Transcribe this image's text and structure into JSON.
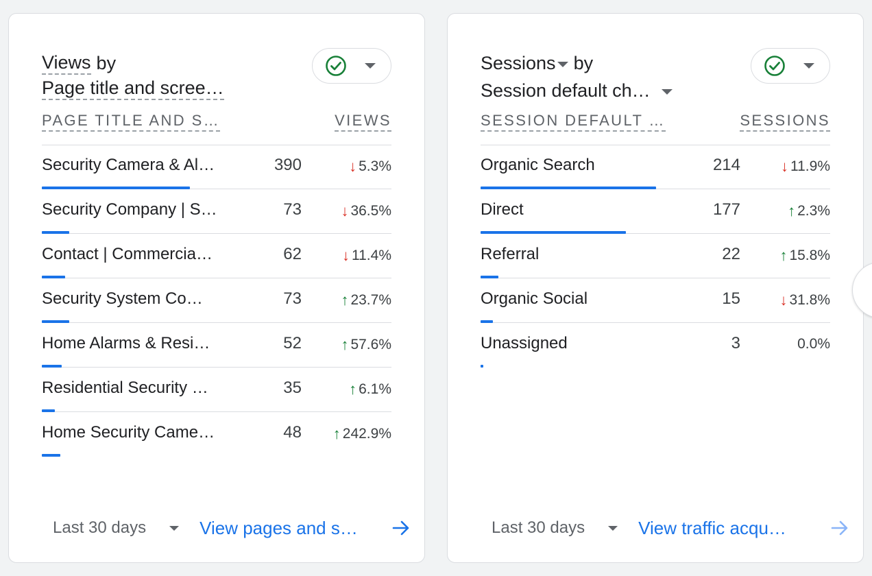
{
  "cards": [
    {
      "title_metric": "Views",
      "title_by": "by",
      "title_dimension": "Page title and scree…",
      "col_dim": "Page title and s…",
      "col_metric": "Views",
      "rows": [
        {
          "label": "Security Camera & Al…",
          "value": "390",
          "change": "5.3%",
          "dir": "down",
          "bar_fraction": 1.0
        },
        {
          "label": "Security Company | S…",
          "value": "73",
          "change": "36.5%",
          "dir": "down",
          "bar_fraction": 0.187
        },
        {
          "label": "Contact | Commercia…",
          "value": "62",
          "change": "11.4%",
          "dir": "down",
          "bar_fraction": 0.159
        },
        {
          "label": "Security System Co…",
          "value": "73",
          "change": "23.7%",
          "dir": "up",
          "bar_fraction": 0.187
        },
        {
          "label": "Home Alarms & Resi…",
          "value": "52",
          "change": "57.6%",
          "dir": "up",
          "bar_fraction": 0.133
        },
        {
          "label": "Residential Security …",
          "value": "35",
          "change": "6.1%",
          "dir": "up",
          "bar_fraction": 0.09
        },
        {
          "label": "Home Security Came…",
          "value": "48",
          "change": "242.9%",
          "dir": "up",
          "bar_fraction": 0.123
        }
      ],
      "range_label": "Last 30 days",
      "link_label": "View pages and s…"
    },
    {
      "title_metric": "Sessions",
      "title_by": "by",
      "title_dimension": "Session default ch…",
      "col_dim": "Session default …",
      "col_metric": "Sessions",
      "rows": [
        {
          "label": "Organic Search",
          "value": "214",
          "change": "11.9%",
          "dir": "down",
          "bar_fraction": 1.0
        },
        {
          "label": "Direct",
          "value": "177",
          "change": "2.3%",
          "dir": "up",
          "bar_fraction": 0.827
        },
        {
          "label": "Referral",
          "value": "22",
          "change": "15.8%",
          "dir": "up",
          "bar_fraction": 0.103
        },
        {
          "label": "Organic Social",
          "value": "15",
          "change": "31.8%",
          "dir": "down",
          "bar_fraction": 0.07
        },
        {
          "label": "Unassigned",
          "value": "3",
          "change": "0.0%",
          "dir": "none",
          "bar_fraction": 0.014
        }
      ],
      "range_label": "Last 30 days",
      "link_label": "View traffic acqu…"
    }
  ],
  "colors": {
    "accent": "#1a73e8",
    "up": "#188038",
    "down": "#d93025",
    "check": "#188038"
  },
  "icons": [
    "check-circle-icon",
    "chevron-down-icon",
    "arrow-right-icon",
    "arrow-up-icon",
    "arrow-down-icon"
  ]
}
